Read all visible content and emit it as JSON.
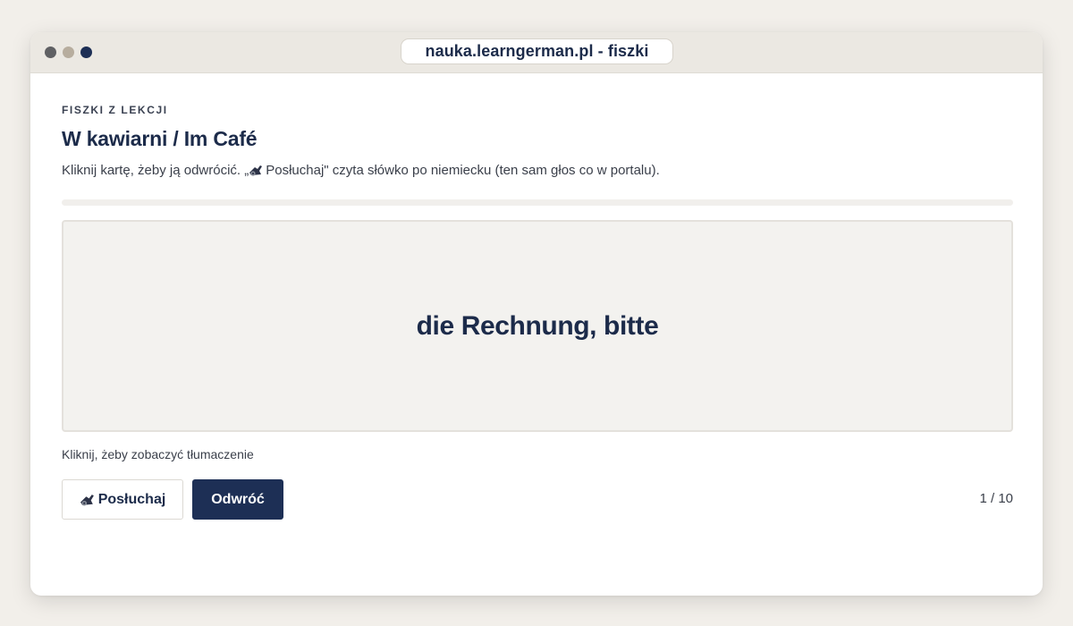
{
  "window": {
    "url": "nauka.learngerman.pl - fiszki"
  },
  "lesson": {
    "eyebrow": "FISZKI Z LEKCJI",
    "title": "W kawiarni / Im Café",
    "subtitle_before": "Kliknij kartę, żeby ją odwrócić. „",
    "subtitle_after": "Posłuchaj\" czyta słówko po niemiecku (ten sam głos co w portalu)."
  },
  "progress": {
    "current": 1,
    "total": 10,
    "fill_fraction": 0.0
  },
  "card": {
    "front_text": "die Rechnung, bitte",
    "hint": "Kliknij, żeby zobaczyć tłumaczenie"
  },
  "buttons": {
    "listen_label": "Posłuchaj",
    "flip_label": "Odwróć"
  },
  "counter_text": "1 / 10",
  "icons": {
    "listen": "speaker-icon"
  },
  "colors": {
    "accent": "#1d2f55",
    "text": "#1c2b4a",
    "card_bg": "#f3f2ef",
    "page_bg": "#f2efea"
  }
}
